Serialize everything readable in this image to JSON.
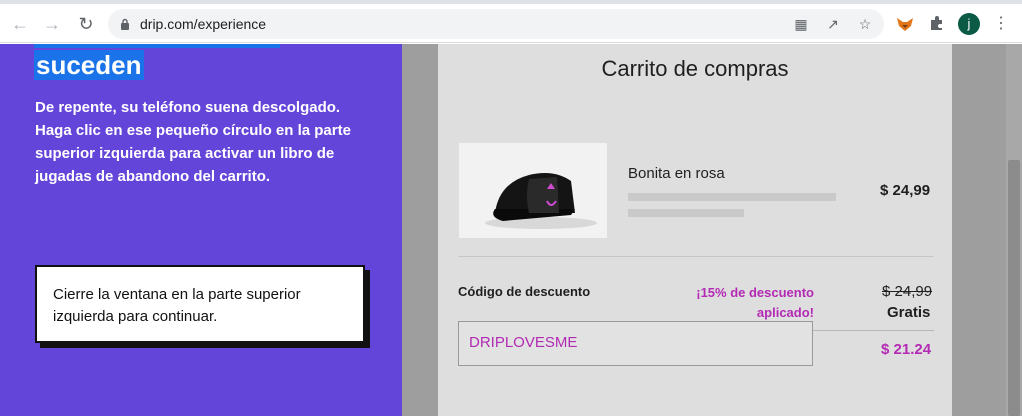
{
  "browser": {
    "url": "drip.com/experience",
    "avatar_letter": "j"
  },
  "left_panel": {
    "heading": "suceden",
    "description": "De repente, su teléfono suena descolgado. Haga clic en ese pequeño círculo en la parte superior izquierda para activar un libro de jugadas de abandono del carrito.",
    "toast": "Cierre la ventana en la parte superior izquierda para continuar."
  },
  "cart": {
    "title": "Carrito de compras",
    "product_name": "Bonita en rosa",
    "product_price": "$ 24,99",
    "discount_label": "Código de descuento",
    "discount_applied": "¡15% de descuento aplicado!",
    "original_price": "$ 24,99",
    "shipping": "Gratis",
    "discount_code": "DRIPLOVESME",
    "total": "$ 21.24"
  },
  "colors": {
    "panel_purple": "#6445d9",
    "accent_magenta": "#b32ab4",
    "highlight_blue": "#1a73e8"
  },
  "icons": [
    "back-arrow-icon",
    "forward-arrow-icon",
    "reload-icon",
    "lock-icon",
    "translate-icon",
    "share-icon",
    "star-icon",
    "fox-extension-icon",
    "puzzle-icon",
    "kebab-menu-icon"
  ]
}
